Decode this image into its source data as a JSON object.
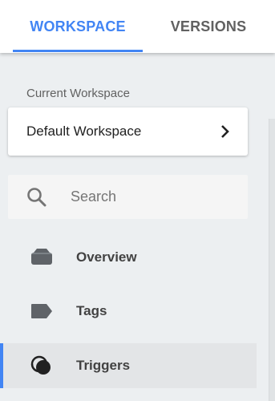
{
  "tabs": [
    {
      "label": "WORKSPACE",
      "active": true
    },
    {
      "label": "VERSIONS",
      "active": false
    }
  ],
  "current_workspace": {
    "label": "Current Workspace",
    "name": "Default Workspace"
  },
  "search": {
    "placeholder": "Search",
    "value": ""
  },
  "nav": {
    "items": [
      {
        "label": "Overview",
        "icon": "folder-icon"
      },
      {
        "label": "Tags",
        "icon": "tag-icon"
      },
      {
        "label": "Triggers",
        "icon": "trigger-icon",
        "active": true
      }
    ]
  },
  "colors": {
    "accent": "#4285f4",
    "background": "#eceff1",
    "active_item": "#e3e5e7"
  }
}
